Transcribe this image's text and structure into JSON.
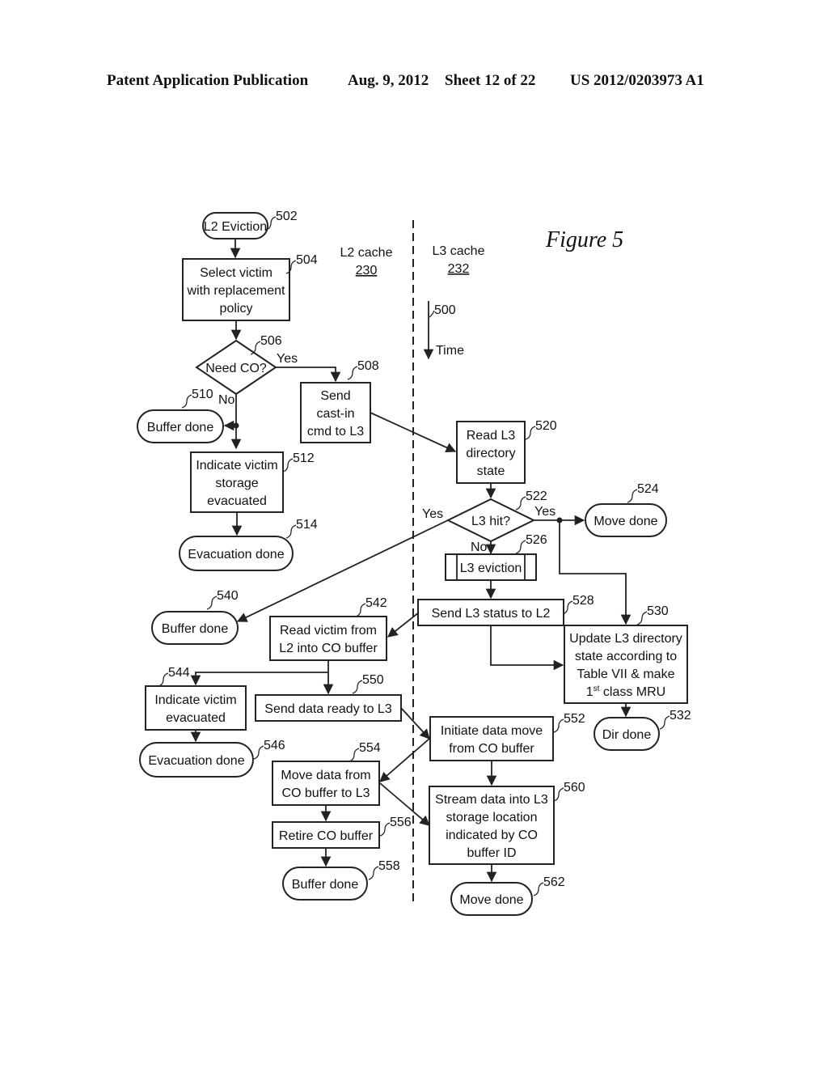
{
  "header": {
    "publication": "Patent Application Publication",
    "date": "Aug. 9, 2012",
    "sheet": "Sheet 12 of 22",
    "number": "US 2012/0203973 A1"
  },
  "figure": {
    "title": "Figure 5",
    "lanes": [
      {
        "name": "L2 cache",
        "ref": "230"
      },
      {
        "name": "L3 cache",
        "ref": "232"
      }
    ],
    "time_axis": {
      "ref": "500",
      "label": "Time"
    }
  },
  "nodes": {
    "n502": {
      "ref": "502",
      "lines": [
        "L2 Eviction"
      ]
    },
    "n504": {
      "ref": "504",
      "lines": [
        "Select victim",
        "with replacement",
        "policy"
      ]
    },
    "n506": {
      "ref": "506",
      "lines": [
        "Need CO?"
      ]
    },
    "n508": {
      "ref": "508",
      "lines": [
        "Send",
        "cast-in",
        "cmd to L3"
      ]
    },
    "n510": {
      "ref": "510",
      "lines": [
        "Buffer done"
      ]
    },
    "n512": {
      "ref": "512",
      "lines": [
        "Indicate victim",
        "storage",
        "evacuated"
      ]
    },
    "n514": {
      "ref": "514",
      "lines": [
        "Evacuation done"
      ]
    },
    "n520": {
      "ref": "520",
      "lines": [
        "Read L3",
        "directory",
        "state"
      ]
    },
    "n522": {
      "ref": "522",
      "lines": [
        "L3 hit?"
      ]
    },
    "n524": {
      "ref": "524",
      "lines": [
        "Move done"
      ]
    },
    "n526": {
      "ref": "526",
      "lines": [
        "L3 eviction"
      ]
    },
    "n528": {
      "ref": "528",
      "lines": [
        "Send L3 status to L2"
      ]
    },
    "n530": {
      "ref": "530",
      "lines": [
        "Update L3 directory",
        "state according to",
        "Table VII & make",
        "1st class MRU"
      ]
    },
    "n532": {
      "ref": "532",
      "lines": [
        "Dir done"
      ]
    },
    "n540": {
      "ref": "540",
      "lines": [
        "Buffer done"
      ]
    },
    "n542": {
      "ref": "542",
      "lines": [
        "Read victim from",
        "L2 into CO buffer"
      ]
    },
    "n544": {
      "ref": "544",
      "lines": [
        "Indicate victim",
        "evacuated"
      ]
    },
    "n546": {
      "ref": "546",
      "lines": [
        "Evacuation done"
      ]
    },
    "n550": {
      "ref": "550",
      "lines": [
        "Send data ready to L3"
      ]
    },
    "n552": {
      "ref": "552",
      "lines": [
        "Initiate data move",
        "from CO buffer"
      ]
    },
    "n554": {
      "ref": "554",
      "lines": [
        "Move data from",
        "CO buffer to L3"
      ]
    },
    "n556": {
      "ref": "556",
      "lines": [
        "Retire CO buffer"
      ]
    },
    "n558": {
      "ref": "558",
      "lines": [
        "Buffer done"
      ]
    },
    "n560": {
      "ref": "560",
      "lines": [
        "Stream data into L3",
        "storage location",
        "indicated by CO",
        "buffer ID"
      ]
    },
    "n562": {
      "ref": "562",
      "lines": [
        "Move done"
      ]
    }
  },
  "edge_labels": {
    "d506_yes": "Yes",
    "d506_no": "No",
    "d522_yes_left": "Yes",
    "d522_yes_right": "Yes",
    "d522_no": "No"
  }
}
